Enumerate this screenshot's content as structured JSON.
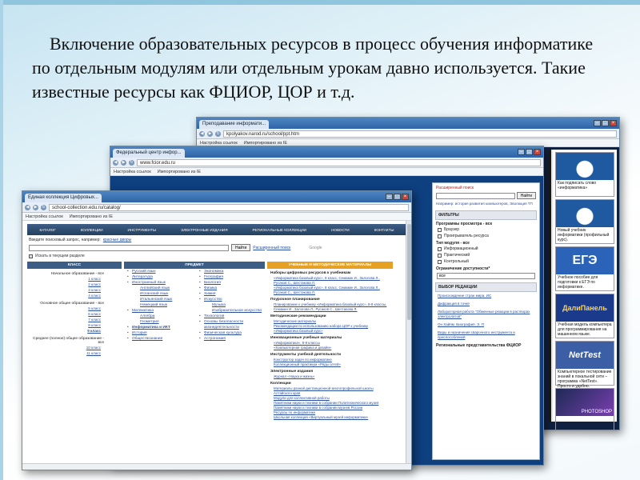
{
  "slide": {
    "text": "Включение образовательных ресурсов  в процесс обучения информатике  по отдельным модулям или отдельным урокам давно используется.  Такие  известные ресурсы  как  ФЦИОР, ЦОР и т.д."
  },
  "colors": {
    "accent_blue": "#2f64a6",
    "link": "#2a4fa0",
    "orange_header": "#e6a124",
    "page_dark": "#0e3f7f"
  },
  "browser_polyakov": {
    "tab": "Преподавание информати...",
    "url": "kpolyakov.narod.ru/school/ppt.htm",
    "bookmarks": [
      "Настройка ссылок",
      "Импортировано из IE"
    ],
    "sidebar": [
      {
        "caption": "Как подписать слово «информатика»",
        "icon": "faces-icon"
      },
      {
        "caption": "Новый учебник информатики (профильный курс).",
        "icon": "book-icon"
      },
      {
        "title": "ЕГЭ",
        "caption": "Учебное пособие для подготовки к ЕГЭ по информатике."
      },
      {
        "title": "ДалиПанель",
        "caption": "Учебная модель компьютера для программирования на машинном языке."
      },
      {
        "title": "NetTest",
        "caption": "Компьютерное тестирование знаний в локальной сети – программа «NetTest». Просто и удобно."
      },
      {
        "title": "PHOTOSHOP",
        "caption": ""
      }
    ]
  },
  "browser_fcior": {
    "tab": "Федеральный центр инфор...",
    "url": "www.fcior.edu.ru",
    "bookmarks": [
      "Настройка ссылок",
      "Импортировано из IE"
    ],
    "panel": {
      "search_head": "Расширенный поиск",
      "search_button": "Найти",
      "search_hint": "Например: история развития компьютеров, Эволюция ТП",
      "filters_title": "ФИЛЬТРЫ",
      "programs_label": "Программы просмотра - все",
      "programs": [
        "Браузер",
        "Проигрыватель ресурса"
      ],
      "modules_label": "Тип модуля - все",
      "modules": [
        "Информационный",
        "Практический",
        "Контрольный"
      ],
      "access_label": "Ограничение доступности*",
      "access_value": "все",
      "editor_title": "ВЫБОР РЕДАКЦИИ",
      "editor_links": [
        "Происхождение стран мира. ИС",
        "Дифракция в точке",
        "Лабораторная работа \"Обменные реакции в растворах электролитов\"",
        "Он Хайям. Биография. Э. П",
        "Виды и назначения сварочного инструмента и приспособлений"
      ],
      "footer": "Региональные представительства ФЦИОР"
    }
  },
  "browser_sc": {
    "tab": "Единая коллекция Цифровых...",
    "url": "school-collection.edu.ru/catalog/",
    "bookmarks": [
      "Настройка ссылок",
      "Импортировано из IE"
    ],
    "menu": [
      "Каталог",
      "Коллекции",
      "Инструменты",
      "Электронные издания",
      "Региональные коллекции",
      "Новости",
      "Контакты"
    ],
    "search_label": "Введите поисковый запрос, например:",
    "search_example": "красные дворы",
    "search_button": "Найти",
    "search_link": "Расширенный поиск",
    "search_google": "Google",
    "search_check": "Искать в текущем разделе",
    "col_class": "Класс",
    "col_subject": "Предмет",
    "col_materials": "Учебные и методические материалы",
    "levels": [
      {
        "name": "Начальное образование - все",
        "classes": [
          "1 класс",
          "2 класс",
          "3 класс",
          "4 класс"
        ]
      },
      {
        "name": "Основное общее образование - все",
        "classes": [
          "5 класс",
          "6 класс",
          "7 класс",
          "8 класс",
          "9 класс"
        ]
      },
      {
        "name": "Среднее (полное) общее образование - все",
        "classes": [
          "10 класс",
          "11 класс"
        ]
      }
    ],
    "subjects_a": [
      "Русский язык",
      "Литература",
      "Иностранный язык",
      "Английский язык",
      "Испанский язык",
      "Итальянский язык",
      "Немецкий язык",
      "Математика",
      "Алгебра",
      "Геометрия",
      "Информатика и ИКТ",
      "История",
      "Обществознание"
    ],
    "subjects_b": [
      "Экономика",
      "География",
      "Биология",
      "Физика",
      "Химия",
      "Искусство",
      "Музыка",
      "Изобразительное искусство",
      "Технология",
      "Основы безопасности жизнедеятельности",
      "Физическая культура",
      "Астрономия"
    ],
    "materials": [
      {
        "h": "Наборы цифровых ресурсов к учебникам",
        "l": [
          "«Информатика базовый курс», 9 класс, Семакин И., Залогова Л., Русаков С., Шестакова Л.",
          "«Информатика базовый курс», 8 класс, Семакин И., Залогова Л., Русаков С., Шестакова Л."
        ]
      },
      {
        "h": "Поурочное планирование",
        "l": [
          "Планирование к учебнику «Информатика базовый курс», 8-9 классы, Семакин И., Залогова Л., Русаков С., Шестакова Л."
        ]
      },
      {
        "h": "Методические рекомендации",
        "l": [
          "Методические материалы",
          "Рекомендации по использованию набора ЦОР к учебнику «Информатика базовый курс»"
        ]
      },
      {
        "h": "Инновационные учебные материалы",
        "l": [
          "«Информатика», 8-9 классы",
          "«Компьютерная графика и дизайн»"
        ]
      },
      {
        "h": "Инструменты учебной деятельности",
        "l": [
          "Конструктор задач по информатике",
          "Коллекционный практикум «Ряды сетей»"
        ]
      },
      {
        "h": "Электронные издания",
        "l": [
          "Журнал «Наука и жизнь»"
        ]
      },
      {
        "h": "Коллекции",
        "l": [
          "Материалы разной дистанционной многопрофильной школы Алтайского края",
          "Модули для коллективной работы",
          "Памятники науки и техники в собрании Политехнического музея",
          "Памятники науки и техники в собрании музеев России",
          "Ресурсы по информатике",
          "Школьная коллекция «Виртуальный музей информатики»"
        ]
      }
    ]
  }
}
